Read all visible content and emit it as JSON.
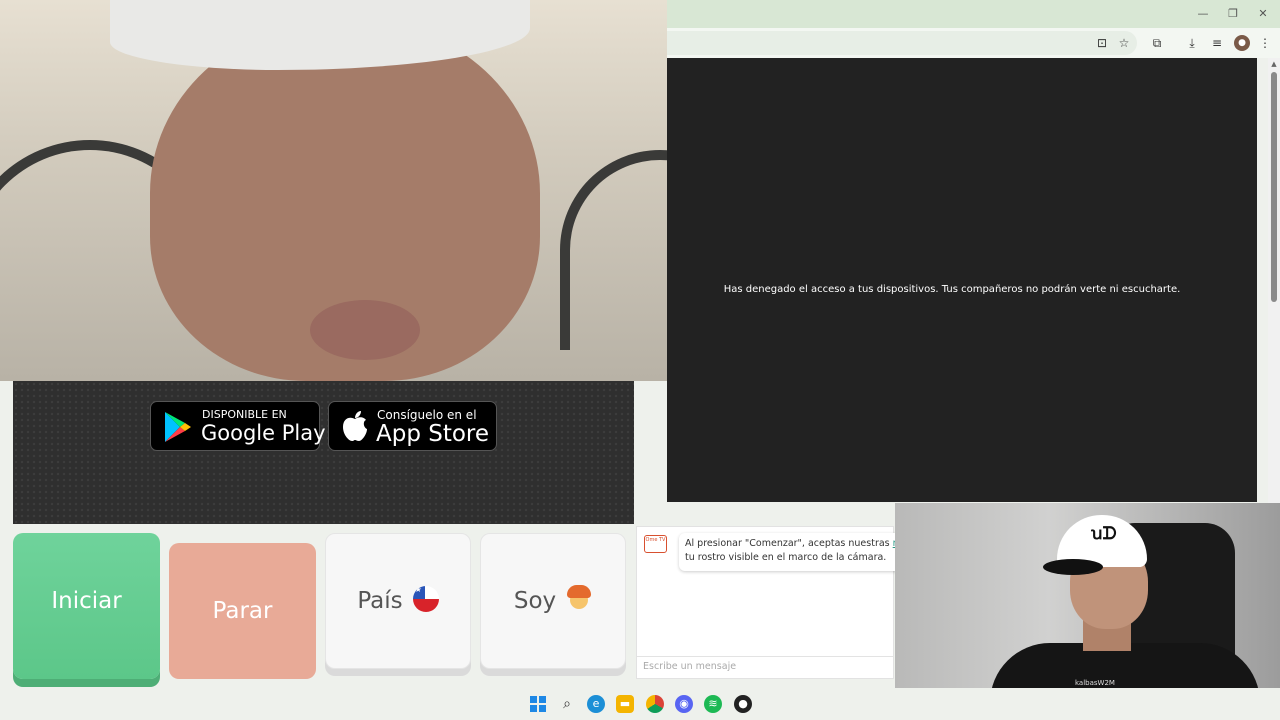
{
  "store_badges": {
    "google_play": {
      "small": "DISPONIBLE EN",
      "big": "Google Play"
    },
    "app_store": {
      "small": "Consíguelo en el",
      "big": "App Store"
    }
  },
  "content": {
    "denied_message": "Has denegado el acceso a tus dispositivos. Tus compañeros no podrán verte ni escucharte."
  },
  "controls": {
    "start_label": "Iniciar",
    "stop_label": "Parar",
    "country_label": "País",
    "gender_label": "Soy"
  },
  "chat": {
    "logo_text": "Ome TV",
    "message_line1": "Al presionar \"Comenzar\", aceptas nuestras",
    "rules_link": "regla",
    "message_line2": "tu rostro visible en el marco de la cámara.",
    "input_placeholder": "Escribe un mensaje"
  },
  "webcam": {
    "cap_logo": "ꭒᗪ",
    "shirt_text": "kalbasW2M"
  },
  "colors": {
    "start": "#5cc789",
    "stop": "#e8aa97",
    "link": "#2a9a86",
    "titlebar": "#d8e7d4"
  },
  "icons": {
    "window": [
      "minimize-icon",
      "restore-icon",
      "close-icon"
    ],
    "toolbar": [
      "install-icon",
      "star-icon",
      "extensions-icon",
      "download-icon",
      "media-icon",
      "profile-icon",
      "menu-icon"
    ],
    "taskbar": [
      "windows-start-icon",
      "search-icon",
      "edge-icon",
      "file-explorer-icon",
      "chrome-icon",
      "discord-icon",
      "spotify-icon",
      "obs-icon"
    ]
  }
}
